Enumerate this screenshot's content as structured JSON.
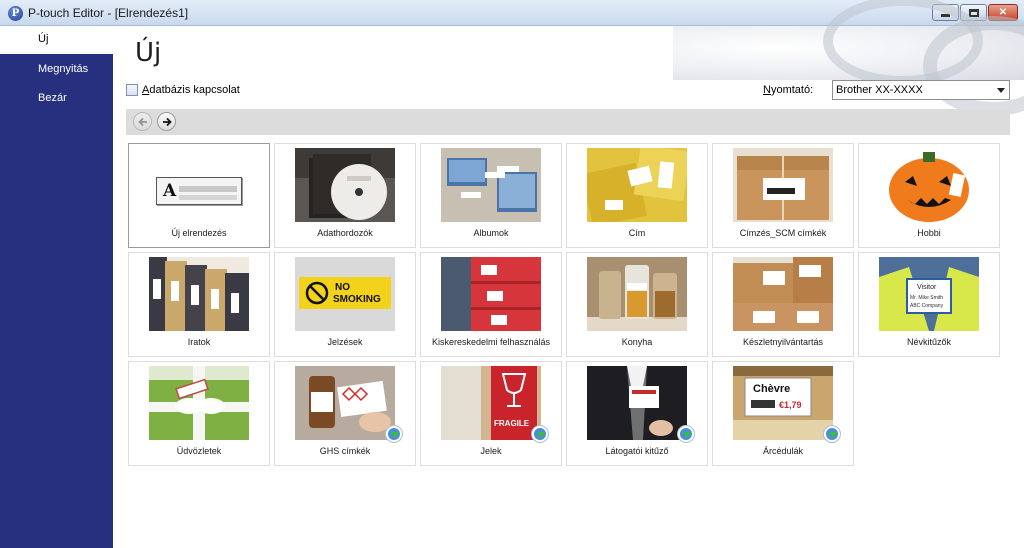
{
  "window": {
    "title": "P-touch Editor - [Elrendezés1]",
    "app_icon_letter": "P"
  },
  "sidebar": {
    "items": [
      {
        "label": "Új",
        "active": true
      },
      {
        "label": "Megnyitás",
        "active": false
      },
      {
        "label": "Bezár",
        "active": false
      }
    ]
  },
  "main": {
    "title": "Új",
    "database_checkbox": {
      "label_prefix": "A",
      "label_rest": "datbázis kapcsolat",
      "checked": false
    },
    "printer": {
      "label_prefix": "N",
      "label_rest": "yomtató:",
      "value": "Brother XX-XXXX"
    },
    "nav": {
      "back_icon": "arrow-left-icon",
      "forward_icon": "arrow-right-icon"
    }
  },
  "templates": [
    {
      "label": "Új elrendezés",
      "download": false,
      "selected": true
    },
    {
      "label": "Adathordozók",
      "download": false
    },
    {
      "label": "Albumok",
      "download": false
    },
    {
      "label": "Cím",
      "download": false
    },
    {
      "label": "Címzés_SCM címkék",
      "download": false
    },
    {
      "label": "Hobbi",
      "download": false
    },
    {
      "label": "Iratok",
      "download": false
    },
    {
      "label": "Jelzések",
      "download": false
    },
    {
      "label": "Kiskereskedelmi felhasználás",
      "download": false
    },
    {
      "label": "Konyha",
      "download": false
    },
    {
      "label": "Készletnyilvántartás",
      "download": false
    },
    {
      "label": "Névkitűzők",
      "download": false
    },
    {
      "label": "Üdvözletek",
      "download": false
    },
    {
      "label": "GHS címkék",
      "download": true
    },
    {
      "label": "Jelek",
      "download": true
    },
    {
      "label": "Látogatói kitűző",
      "download": true
    },
    {
      "label": "Árcédulák",
      "download": true
    }
  ],
  "thumb_text": {
    "no_smoking_1": "NO",
    "no_smoking_2": "SMOKING",
    "fragile": "FRAGILE",
    "visitor": "Visitor",
    "visitor_name": "Mr. Mike Smith",
    "visitor_company": "ABC Company",
    "price_name": "Chèvre",
    "price_value": "€1,79"
  },
  "colors": {
    "sidebar_bg": "#27307e",
    "accent_yellow": "#f2d21a",
    "nav_bar": "#dcdcdc"
  }
}
